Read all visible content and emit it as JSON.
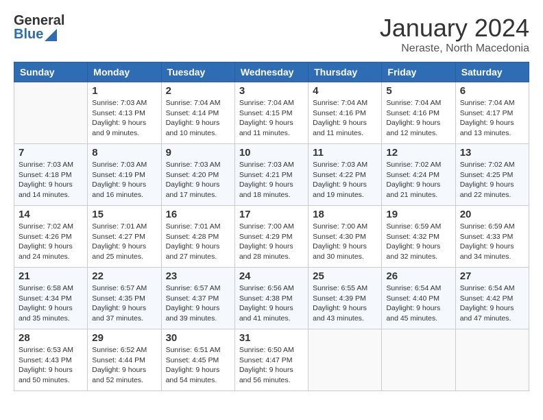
{
  "header": {
    "logo_general": "General",
    "logo_blue": "Blue",
    "month_title": "January 2024",
    "location": "Neraste, North Macedonia"
  },
  "days_of_week": [
    "Sunday",
    "Monday",
    "Tuesday",
    "Wednesday",
    "Thursday",
    "Friday",
    "Saturday"
  ],
  "weeks": [
    [
      {
        "day": "",
        "empty": true
      },
      {
        "day": "1",
        "sunrise": "Sunrise: 7:03 AM",
        "sunset": "Sunset: 4:13 PM",
        "daylight": "Daylight: 9 hours and 9 minutes."
      },
      {
        "day": "2",
        "sunrise": "Sunrise: 7:04 AM",
        "sunset": "Sunset: 4:14 PM",
        "daylight": "Daylight: 9 hours and 10 minutes."
      },
      {
        "day": "3",
        "sunrise": "Sunrise: 7:04 AM",
        "sunset": "Sunset: 4:15 PM",
        "daylight": "Daylight: 9 hours and 11 minutes."
      },
      {
        "day": "4",
        "sunrise": "Sunrise: 7:04 AM",
        "sunset": "Sunset: 4:16 PM",
        "daylight": "Daylight: 9 hours and 11 minutes."
      },
      {
        "day": "5",
        "sunrise": "Sunrise: 7:04 AM",
        "sunset": "Sunset: 4:16 PM",
        "daylight": "Daylight: 9 hours and 12 minutes."
      },
      {
        "day": "6",
        "sunrise": "Sunrise: 7:04 AM",
        "sunset": "Sunset: 4:17 PM",
        "daylight": "Daylight: 9 hours and 13 minutes."
      }
    ],
    [
      {
        "day": "7",
        "sunrise": "Sunrise: 7:03 AM",
        "sunset": "Sunset: 4:18 PM",
        "daylight": "Daylight: 9 hours and 14 minutes."
      },
      {
        "day": "8",
        "sunrise": "Sunrise: 7:03 AM",
        "sunset": "Sunset: 4:19 PM",
        "daylight": "Daylight: 9 hours and 16 minutes."
      },
      {
        "day": "9",
        "sunrise": "Sunrise: 7:03 AM",
        "sunset": "Sunset: 4:20 PM",
        "daylight": "Daylight: 9 hours and 17 minutes."
      },
      {
        "day": "10",
        "sunrise": "Sunrise: 7:03 AM",
        "sunset": "Sunset: 4:21 PM",
        "daylight": "Daylight: 9 hours and 18 minutes."
      },
      {
        "day": "11",
        "sunrise": "Sunrise: 7:03 AM",
        "sunset": "Sunset: 4:22 PM",
        "daylight": "Daylight: 9 hours and 19 minutes."
      },
      {
        "day": "12",
        "sunrise": "Sunrise: 7:02 AM",
        "sunset": "Sunset: 4:24 PM",
        "daylight": "Daylight: 9 hours and 21 minutes."
      },
      {
        "day": "13",
        "sunrise": "Sunrise: 7:02 AM",
        "sunset": "Sunset: 4:25 PM",
        "daylight": "Daylight: 9 hours and 22 minutes."
      }
    ],
    [
      {
        "day": "14",
        "sunrise": "Sunrise: 7:02 AM",
        "sunset": "Sunset: 4:26 PM",
        "daylight": "Daylight: 9 hours and 24 minutes."
      },
      {
        "day": "15",
        "sunrise": "Sunrise: 7:01 AM",
        "sunset": "Sunset: 4:27 PM",
        "daylight": "Daylight: 9 hours and 25 minutes."
      },
      {
        "day": "16",
        "sunrise": "Sunrise: 7:01 AM",
        "sunset": "Sunset: 4:28 PM",
        "daylight": "Daylight: 9 hours and 27 minutes."
      },
      {
        "day": "17",
        "sunrise": "Sunrise: 7:00 AM",
        "sunset": "Sunset: 4:29 PM",
        "daylight": "Daylight: 9 hours and 28 minutes."
      },
      {
        "day": "18",
        "sunrise": "Sunrise: 7:00 AM",
        "sunset": "Sunset: 4:30 PM",
        "daylight": "Daylight: 9 hours and 30 minutes."
      },
      {
        "day": "19",
        "sunrise": "Sunrise: 6:59 AM",
        "sunset": "Sunset: 4:32 PM",
        "daylight": "Daylight: 9 hours and 32 minutes."
      },
      {
        "day": "20",
        "sunrise": "Sunrise: 6:59 AM",
        "sunset": "Sunset: 4:33 PM",
        "daylight": "Daylight: 9 hours and 34 minutes."
      }
    ],
    [
      {
        "day": "21",
        "sunrise": "Sunrise: 6:58 AM",
        "sunset": "Sunset: 4:34 PM",
        "daylight": "Daylight: 9 hours and 35 minutes."
      },
      {
        "day": "22",
        "sunrise": "Sunrise: 6:57 AM",
        "sunset": "Sunset: 4:35 PM",
        "daylight": "Daylight: 9 hours and 37 minutes."
      },
      {
        "day": "23",
        "sunrise": "Sunrise: 6:57 AM",
        "sunset": "Sunset: 4:37 PM",
        "daylight": "Daylight: 9 hours and 39 minutes."
      },
      {
        "day": "24",
        "sunrise": "Sunrise: 6:56 AM",
        "sunset": "Sunset: 4:38 PM",
        "daylight": "Daylight: 9 hours and 41 minutes."
      },
      {
        "day": "25",
        "sunrise": "Sunrise: 6:55 AM",
        "sunset": "Sunset: 4:39 PM",
        "daylight": "Daylight: 9 hours and 43 minutes."
      },
      {
        "day": "26",
        "sunrise": "Sunrise: 6:54 AM",
        "sunset": "Sunset: 4:40 PM",
        "daylight": "Daylight: 9 hours and 45 minutes."
      },
      {
        "day": "27",
        "sunrise": "Sunrise: 6:54 AM",
        "sunset": "Sunset: 4:42 PM",
        "daylight": "Daylight: 9 hours and 47 minutes."
      }
    ],
    [
      {
        "day": "28",
        "sunrise": "Sunrise: 6:53 AM",
        "sunset": "Sunset: 4:43 PM",
        "daylight": "Daylight: 9 hours and 50 minutes."
      },
      {
        "day": "29",
        "sunrise": "Sunrise: 6:52 AM",
        "sunset": "Sunset: 4:44 PM",
        "daylight": "Daylight: 9 hours and 52 minutes."
      },
      {
        "day": "30",
        "sunrise": "Sunrise: 6:51 AM",
        "sunset": "Sunset: 4:45 PM",
        "daylight": "Daylight: 9 hours and 54 minutes."
      },
      {
        "day": "31",
        "sunrise": "Sunrise: 6:50 AM",
        "sunset": "Sunset: 4:47 PM",
        "daylight": "Daylight: 9 hours and 56 minutes."
      },
      {
        "day": "",
        "empty": true
      },
      {
        "day": "",
        "empty": true
      },
      {
        "day": "",
        "empty": true
      }
    ]
  ]
}
